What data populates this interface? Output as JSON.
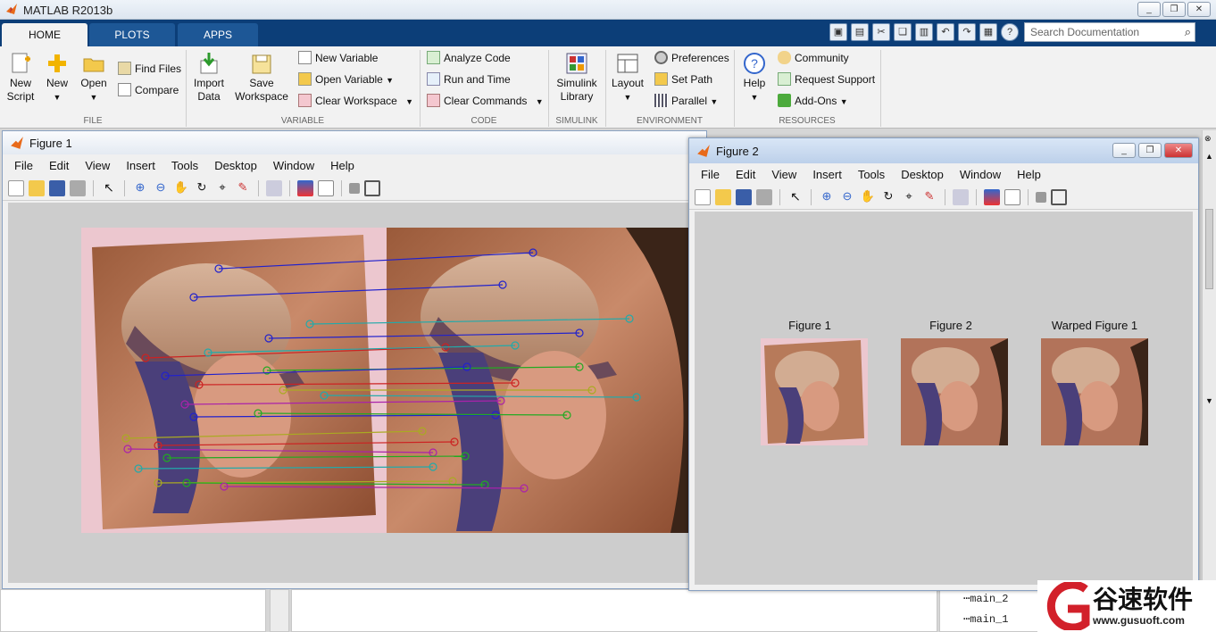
{
  "app": {
    "title": "MATLAB R2013b"
  },
  "window_buttons": [
    "_",
    "❐",
    "✕"
  ],
  "tabs": [
    {
      "label": "HOME"
    },
    {
      "label": "PLOTS"
    },
    {
      "label": "APPS"
    }
  ],
  "search": {
    "placeholder": "Search Documentation"
  },
  "ribbon": {
    "file": {
      "section": "FILE",
      "new_script": "New\nScript",
      "new": "New",
      "open": "Open",
      "find_files": "Find Files",
      "compare": "Compare"
    },
    "variable": {
      "section": "VARIABLE",
      "import_data": "Import\nData",
      "save_workspace": "Save\nWorkspace",
      "new_variable": "New Variable",
      "open_variable": "Open Variable",
      "clear_workspace": "Clear Workspace"
    },
    "code": {
      "section": "CODE",
      "analyze_code": "Analyze Code",
      "run_and_time": "Run and Time",
      "clear_commands": "Clear Commands"
    },
    "simulink": {
      "section": "SIMULINK",
      "library": "Simulink\nLibrary"
    },
    "environment": {
      "section": "ENVIRONMENT",
      "layout": "Layout",
      "preferences": "Preferences",
      "set_path": "Set Path",
      "parallel": "Parallel"
    },
    "resources": {
      "section": "RESOURCES",
      "help": "Help",
      "community": "Community",
      "request_support": "Request Support",
      "add_ons": "Add-Ons"
    }
  },
  "figure1": {
    "title": "Figure 1",
    "menu": [
      "File",
      "Edit",
      "View",
      "Insert",
      "Tools",
      "Desktop",
      "Window",
      "Help"
    ]
  },
  "figure2": {
    "title": "Figure 2",
    "menu": [
      "File",
      "Edit",
      "View",
      "Insert",
      "Tools",
      "Desktop",
      "Window",
      "Help"
    ],
    "subplot_titles": [
      "Figure 1",
      "Figure 2",
      "Warped Figure 1"
    ]
  },
  "tree": [
    "main_2",
    "main_1"
  ],
  "watermark": {
    "brand": "谷速软件",
    "url": "www.gusuoft.com"
  },
  "colors": {
    "tabbar": "#0c3e78",
    "accent": "#1d5796"
  }
}
